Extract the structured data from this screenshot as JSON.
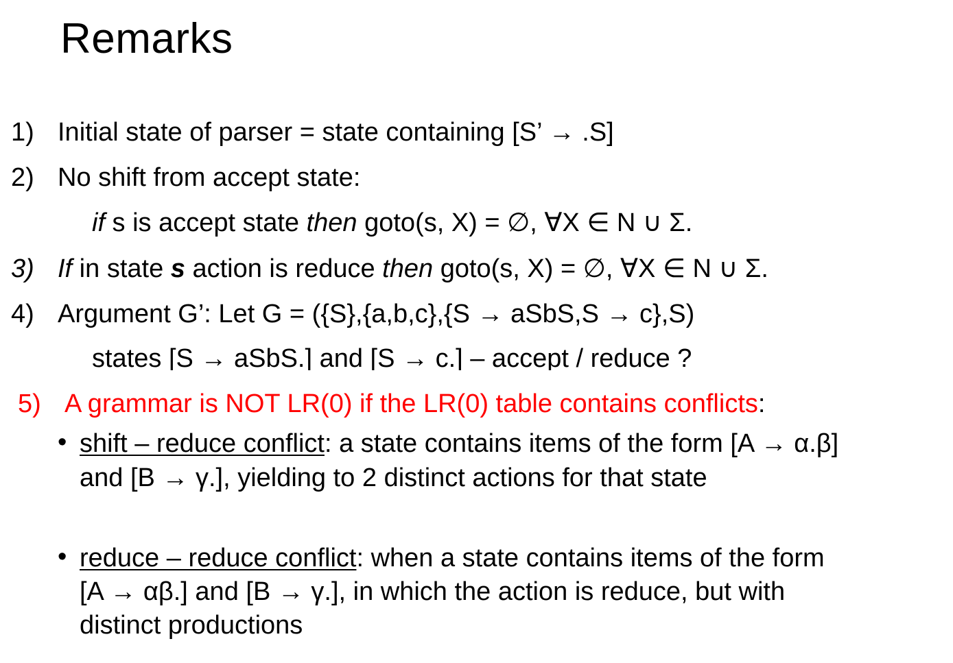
{
  "title": "Remarks",
  "items": {
    "r1": {
      "num": "1)",
      "text": "Initial state of parser  = state containing [S’ → .S]"
    },
    "r2": {
      "num": "2)",
      "text": "No shift from accept state:",
      "sub": {
        "if": "if",
        "a": " s is accept state ",
        "then": "then",
        "b": " goto(s, X) = ∅, ∀X ∈ N ∪ Σ."
      }
    },
    "r3": {
      "num": "3)",
      "if": "If",
      "a": " in state ",
      "s": "s",
      "b": " action is reduce ",
      "then": "then",
      "c": " goto(s, X) = ∅, ∀X ∈ N ∪ Σ."
    },
    "r4": {
      "num": "4)",
      "text": "Argument G’: Let G = ({S},{a,b,c},{S → aSbS,S → c},S)",
      "sub": "states [S → aSbS.] and [S → c.] – accept / reduce ?"
    },
    "r5": {
      "num": "5)",
      "text": "A grammar is NOT LR(0) if the LR(0) table contains conflicts",
      "colon": ":",
      "bullets": [
        {
          "term": "shift – reduce conflict",
          "line1": ": a state contains items of the form [A → α.β]",
          "line2": "and [B → γ.], yielding to 2 distinct actions for that state"
        },
        {
          "term": "reduce – reduce conflict",
          "line1": ": when a state contains items of the form",
          "line2": "[A → αβ.]  and [B → γ.], in which the action is reduce, but with",
          "line3": "distinct productions"
        }
      ]
    }
  },
  "colors": {
    "text": "#000000",
    "highlight": "#ff0000",
    "background": "#ffffff"
  }
}
